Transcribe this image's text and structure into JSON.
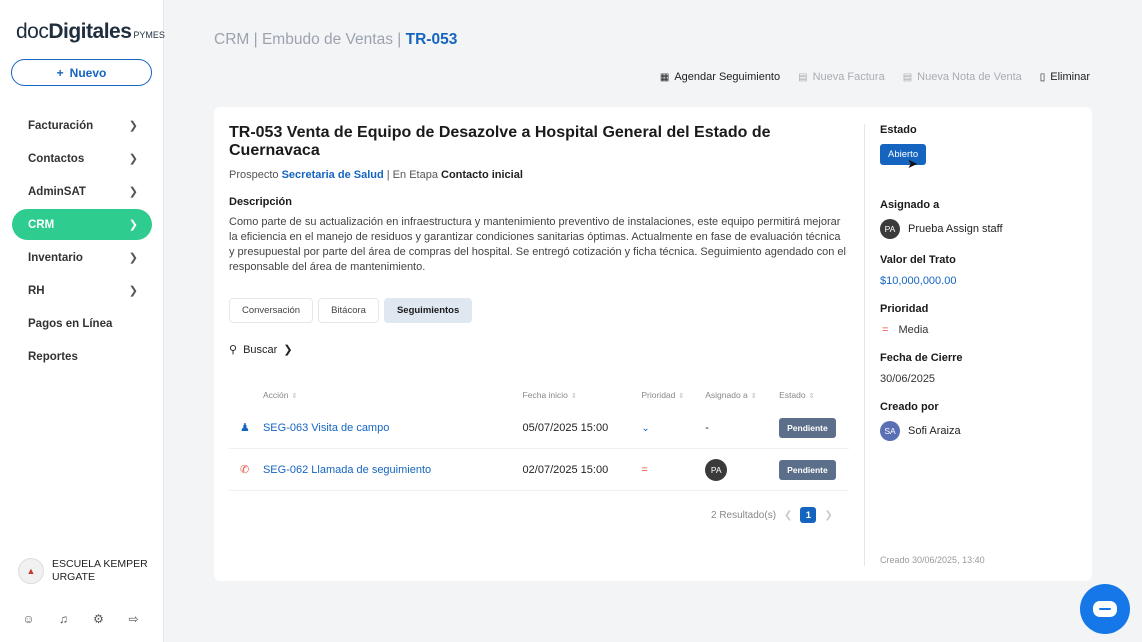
{
  "brand": {
    "part1": "doc",
    "part2": "Digitales",
    "part3": "PYMES"
  },
  "sidebar": {
    "new_label": "Nuevo",
    "items": [
      {
        "label": "Facturación",
        "chevron": true
      },
      {
        "label": "Contactos",
        "chevron": true
      },
      {
        "label": "AdminSAT",
        "chevron": true
      },
      {
        "label": "CRM",
        "chevron": true,
        "active": true
      },
      {
        "label": "Inventario",
        "chevron": true
      },
      {
        "label": "RH",
        "chevron": true
      },
      {
        "label": "Pagos en Línea",
        "chevron": false
      },
      {
        "label": "Reportes",
        "chevron": false
      }
    ],
    "org_line1": "ESCUELA KEMPER",
    "org_line2": "URGATE"
  },
  "breadcrumb": {
    "part1": "CRM",
    "part2": "Embudo de Ventas",
    "current": "TR-053",
    "sep": "|"
  },
  "toolbar": {
    "schedule": "Agendar Seguimiento",
    "invoice": "Nueva Factura",
    "sale_note": "Nueva Nota de Venta",
    "delete": "Eliminar"
  },
  "deal": {
    "title": "TR-053  Venta de Equipo de Desazolve a Hospital General del Estado de Cuernavaca",
    "prospect_label": "Prospecto",
    "prospect": "Secretaria de Salud",
    "stage_label": "| En Etapa",
    "stage": "Contacto inicial",
    "desc_heading": "Descripción",
    "description": "Como parte de su actualización en infraestructura y mantenimiento preventivo de instalaciones, este equipo permitirá mejorar la eficiencia en el manejo de residuos y garantizar condiciones sanitarias óptimas. Actualmente en fase de evaluación técnica y presupuestal por parte del área de compras del hospital. Se entregó cotización y ficha técnica. Seguimiento agendado con el responsable del área de mantenimiento."
  },
  "tabs": [
    "Conversación",
    "Bitácora",
    "Seguimientos"
  ],
  "search_label": "Buscar",
  "table": {
    "headers": {
      "action": "Acción",
      "date": "Fecha inicio",
      "priority": "Prioridad",
      "assigned": "Asignado a",
      "status": "Estado"
    },
    "rows": [
      {
        "action": "SEG-063 Visita de campo",
        "date": "05/07/2025 15:00",
        "assigned": "-",
        "status": "Pendiente"
      },
      {
        "action": "SEG-062 Llamada de seguimiento",
        "date": "02/07/2025 15:00",
        "assigned": "PA",
        "status": "Pendiente"
      }
    ],
    "results": "2 Resultado(s)",
    "page": "1"
  },
  "details": {
    "status_label": "Estado",
    "status": "Abierto",
    "assigned_label": "Asignado a",
    "assigned_initials": "PA",
    "assigned_name": "Prueba Assign staff",
    "value_label": "Valor del Trato",
    "value": "$10,000,000.00",
    "priority_label": "Prioridad",
    "priority": "Media",
    "close_label": "Fecha de Cierre",
    "close_date": "30/06/2025",
    "created_by_label": "Creado por",
    "creator_initials": "SA",
    "creator_name": "Sofi Araiza",
    "created_at": "Creado 30/06/2025, 13:40"
  },
  "colors": {
    "accent": "#1565c0",
    "active_nav": "#2ecc8f",
    "badge": "#5c6f8a",
    "chat": "#1677e8"
  }
}
